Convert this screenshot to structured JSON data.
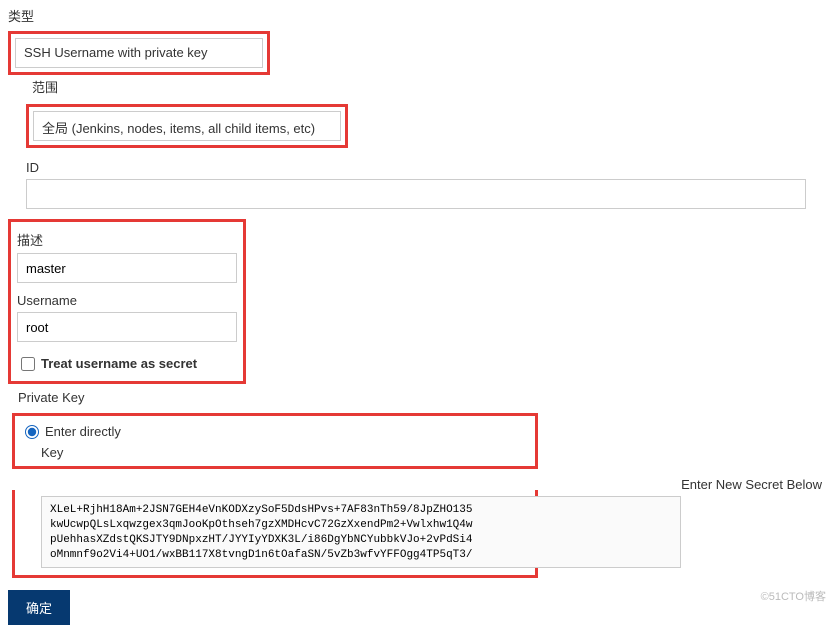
{
  "type": {
    "label": "类型",
    "value": "SSH Username with private key"
  },
  "scope": {
    "label": "范围",
    "value": "全局 (Jenkins, nodes, items, all child items, etc)"
  },
  "id": {
    "label": "ID",
    "value": ""
  },
  "description": {
    "label": "描述",
    "value": "master"
  },
  "username": {
    "label": "Username",
    "value": "root"
  },
  "treat_secret": {
    "label": "Treat username as secret",
    "checked": false
  },
  "private_key": {
    "label": "Private Key",
    "enter_directly": "Enter directly",
    "key_label": "Key",
    "enter_new_secret": "Enter New Secret Below",
    "key_value": "XLeL+RjhH18Am+2JSN7GEH4eVnKODXzySoF5DdsHPvs+7AF83nTh59/8JpZHO135\nkwUcwpQLsLxqwzgex3qmJooKpOthseh7gzXMDHcvC72GzXxendPm2+Vwlxhw1Q4w\npUehhasXZdstQKSJTY9DNpxzHT/JYYIyYDXK3L/i86DgYbNCYubbkVJo+2vPdSi4\noMnmnf9o2Vi4+UO1/wxBB117X8tvngD1n6tOafaSN/5vZb3wfvYFFOgg4TP5qT3/"
  },
  "submit": {
    "label": "确定"
  },
  "watermark": "©51CTO博客"
}
